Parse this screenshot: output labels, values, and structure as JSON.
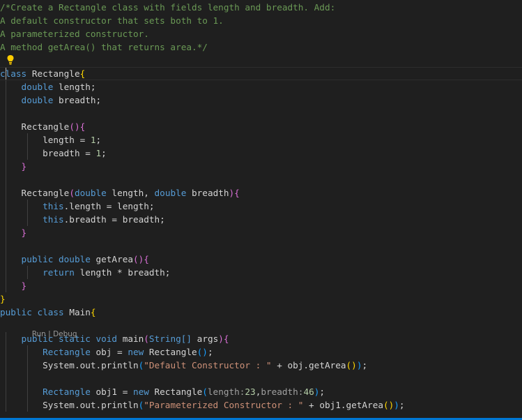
{
  "editor": {
    "lines": [
      [
        {
          "t": "/*Create a Rectangle class with fields length and breadth. Add:",
          "c": "#6a9955"
        }
      ],
      [
        {
          "t": "A default constructor that sets both to 1.",
          "c": "#6a9955"
        }
      ],
      [
        {
          "t": "A parameterized constructor.",
          "c": "#6a9955"
        }
      ],
      [
        {
          "t": "A method getArea() that returns area.*/",
          "c": "#6a9955"
        }
      ],
      [],
      [
        {
          "t": "class",
          "c": "#569cd6"
        },
        {
          "t": " Rectangle",
          "c": "#d4d4d4"
        },
        {
          "t": "{",
          "c": "#ffd700"
        }
      ],
      [
        {
          "t": "    double",
          "c": "#569cd6"
        },
        {
          "t": " length;",
          "c": "#d4d4d4"
        }
      ],
      [
        {
          "t": "    double",
          "c": "#569cd6"
        },
        {
          "t": " breadth;",
          "c": "#d4d4d4"
        }
      ],
      [],
      [
        {
          "t": "    Rectangle",
          "c": "#d4d4d4"
        },
        {
          "t": "()",
          "c": "#da70d6"
        },
        {
          "t": "{",
          "c": "#da70d6"
        }
      ],
      [
        {
          "t": "        length = ",
          "c": "#d4d4d4"
        },
        {
          "t": "1",
          "c": "#b5cea8"
        },
        {
          "t": ";",
          "c": "#d4d4d4"
        }
      ],
      [
        {
          "t": "        breadth = ",
          "c": "#d4d4d4"
        },
        {
          "t": "1",
          "c": "#b5cea8"
        },
        {
          "t": ";",
          "c": "#d4d4d4"
        }
      ],
      [
        {
          "t": "    }",
          "c": "#da70d6"
        }
      ],
      [],
      [
        {
          "t": "    Rectangle",
          "c": "#d4d4d4"
        },
        {
          "t": "(",
          "c": "#da70d6"
        },
        {
          "t": "double",
          "c": "#569cd6"
        },
        {
          "t": " length, ",
          "c": "#d4d4d4"
        },
        {
          "t": "double",
          "c": "#569cd6"
        },
        {
          "t": " breadth",
          "c": "#d4d4d4"
        },
        {
          "t": ")",
          "c": "#da70d6"
        },
        {
          "t": "{",
          "c": "#da70d6"
        }
      ],
      [
        {
          "t": "        this",
          "c": "#569cd6"
        },
        {
          "t": ".length = length;",
          "c": "#d4d4d4"
        }
      ],
      [
        {
          "t": "        this",
          "c": "#569cd6"
        },
        {
          "t": ".breadth = breadth;",
          "c": "#d4d4d4"
        }
      ],
      [
        {
          "t": "    }",
          "c": "#da70d6"
        }
      ],
      [],
      [
        {
          "t": "    public",
          "c": "#569cd6"
        },
        {
          "t": " double",
          "c": "#569cd6"
        },
        {
          "t": " getArea",
          "c": "#d4d4d4"
        },
        {
          "t": "()",
          "c": "#da70d6"
        },
        {
          "t": "{",
          "c": "#da70d6"
        }
      ],
      [
        {
          "t": "        return",
          "c": "#569cd6"
        },
        {
          "t": " length * breadth;",
          "c": "#d4d4d4"
        }
      ],
      [
        {
          "t": "    }",
          "c": "#da70d6"
        }
      ],
      [
        {
          "t": "}",
          "c": "#ffd700"
        }
      ],
      [
        {
          "t": "public",
          "c": "#569cd6"
        },
        {
          "t": " class",
          "c": "#569cd6"
        },
        {
          "t": " Main",
          "c": "#d4d4d4"
        },
        {
          "t": "{",
          "c": "#ffd700"
        }
      ],
      [
        {
          "t": "    public",
          "c": "#569cd6"
        },
        {
          "t": " static",
          "c": "#569cd6"
        },
        {
          "t": " void",
          "c": "#569cd6"
        },
        {
          "t": " main",
          "c": "#d4d4d4"
        },
        {
          "t": "(",
          "c": "#da70d6"
        },
        {
          "t": "String",
          "c": "#569cd6"
        },
        {
          "t": "[]",
          "c": "#569cd6"
        },
        {
          "t": " args",
          "c": "#d4d4d4"
        },
        {
          "t": ")",
          "c": "#da70d6"
        },
        {
          "t": "{",
          "c": "#da70d6"
        }
      ],
      [
        {
          "t": "        Rectangle",
          "c": "#569cd6"
        },
        {
          "t": " obj = ",
          "c": "#d4d4d4"
        },
        {
          "t": "new",
          "c": "#569cd6"
        },
        {
          "t": " Rectangle",
          "c": "#d4d4d4"
        },
        {
          "t": "()",
          "c": "#179fff"
        },
        {
          "t": ";",
          "c": "#d4d4d4"
        }
      ],
      [
        {
          "t": "        System.out.println",
          "c": "#d4d4d4"
        },
        {
          "t": "(",
          "c": "#179fff"
        },
        {
          "t": "\"Default Constructor : \"",
          "c": "#ce9178"
        },
        {
          "t": " + obj.getArea",
          "c": "#d4d4d4"
        },
        {
          "t": "()",
          "c": "#ffd700"
        },
        {
          "t": ")",
          "c": "#179fff"
        },
        {
          "t": ";",
          "c": "#d4d4d4"
        }
      ],
      [],
      [
        {
          "t": "        Rectangle",
          "c": "#569cd6"
        },
        {
          "t": " obj1 = ",
          "c": "#d4d4d4"
        },
        {
          "t": "new",
          "c": "#569cd6"
        },
        {
          "t": " Rectangle",
          "c": "#d4d4d4"
        },
        {
          "t": "(",
          "c": "#179fff"
        },
        {
          "t": "length:",
          "c": "#a0a0a0"
        },
        {
          "t": "23",
          "c": "#b5cea8"
        },
        {
          "t": ",",
          "c": "#d4d4d4"
        },
        {
          "t": "breadth:",
          "c": "#a0a0a0"
        },
        {
          "t": "46",
          "c": "#b5cea8"
        },
        {
          "t": ")",
          "c": "#179fff"
        },
        {
          "t": ";",
          "c": "#d4d4d4"
        }
      ],
      [
        {
          "t": "        System.out.println",
          "c": "#d4d4d4"
        },
        {
          "t": "(",
          "c": "#179fff"
        },
        {
          "t": "\"Parameterized Constructor : \"",
          "c": "#ce9178"
        },
        {
          "t": " + obj1.getArea",
          "c": "#d4d4d4"
        },
        {
          "t": "()",
          "c": "#ffd700"
        },
        {
          "t": ")",
          "c": "#179fff"
        },
        {
          "t": ";",
          "c": "#d4d4d4"
        }
      ]
    ],
    "codelens": {
      "run": "Run",
      "separator": "|",
      "debug": "Debug"
    },
    "icons": {
      "lightbulb": "lightbulb-icon",
      "lightbulb_color": "#ffcc00"
    }
  }
}
